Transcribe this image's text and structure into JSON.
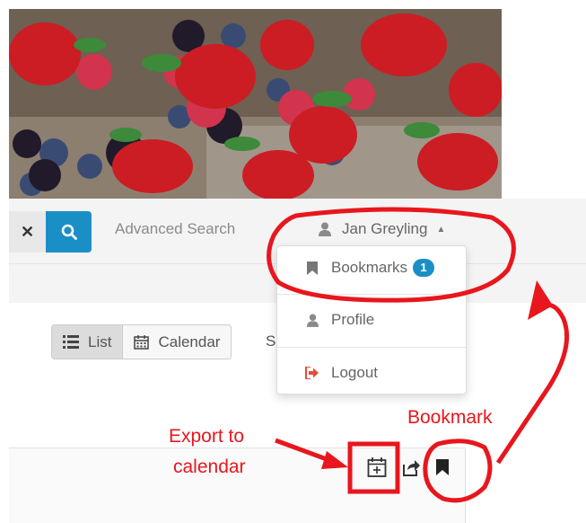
{
  "header": {
    "clear_icon": "close-icon",
    "search_icon": "search-icon",
    "advanced_search_label": "Advanced Search",
    "user_name": "Jan Greyling",
    "user_icon": "user-icon",
    "caret_icon": "caret-up-icon"
  },
  "dropdown": {
    "items": [
      {
        "label": "Bookmarks",
        "icon": "bookmark-icon",
        "badge": "1"
      },
      {
        "label": "Profile",
        "icon": "user-icon"
      },
      {
        "label": "Logout",
        "icon": "sign-out-icon"
      }
    ]
  },
  "views": {
    "list_label": "List",
    "calendar_label": "Calendar",
    "partial_label": "S"
  },
  "annotations": {
    "export_line1": "Export to",
    "export_line2": "calendar",
    "bookmark": "Bookmark"
  },
  "colors": {
    "primary": "#1a8fc6",
    "annotation_red": "#e8161d",
    "logout_icon": "#e74c3c"
  }
}
